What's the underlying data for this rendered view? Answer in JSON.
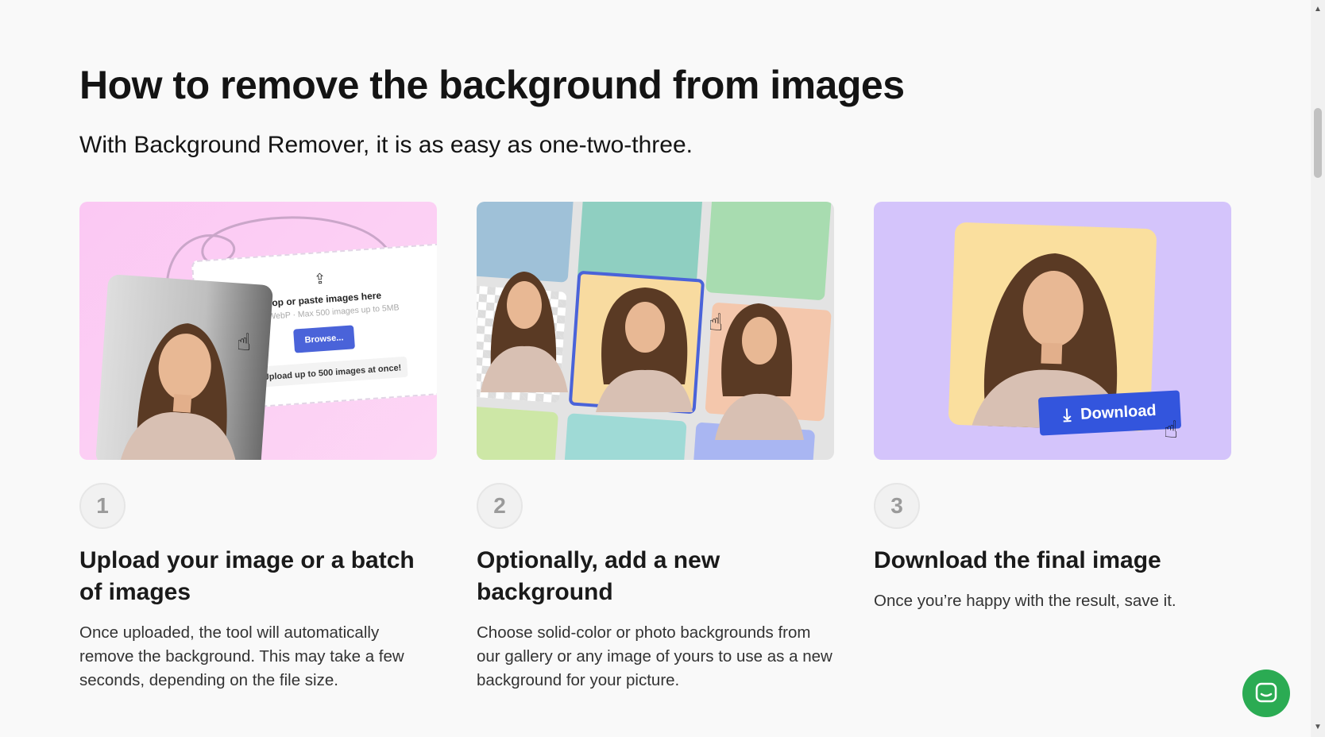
{
  "heading": {
    "title": "How to remove the background from images",
    "subtitle": "With Background Remover, it is as easy as one-two-three."
  },
  "steps": [
    {
      "number": "1",
      "title": "Upload your image or a batch of images",
      "description": "Once uploaded, the tool will automatically remove the background. This may take a few seconds, depending on the file size.",
      "illustration": {
        "drop_title": "Drop or paste images here",
        "drop_formats": "PNG, WebP · Max 500 images up to 5MB",
        "browse_label": "Browse...",
        "note": "Upload up to 500 images at once!",
        "upload_icon": "upload-icon",
        "info_icon": "info-icon"
      }
    },
    {
      "number": "2",
      "title": "Optionally, add a new background",
      "description": "Choose solid-color or photo backgrounds from our gallery or any image of yours to use as a new background for your picture."
    },
    {
      "number": "3",
      "title": "Download the final image",
      "description": "Once you’re happy with the result, save it.",
      "illustration": {
        "download_label": "Download",
        "download_icon": "download-icon"
      }
    }
  ],
  "colors": {
    "card1_bg": "#fbc8f3",
    "card3_bg": "#d4c4fb",
    "accent_blue": "#3355dd",
    "chat_green": "#2bab53"
  },
  "chat_widget": {
    "icon": "chat-icon"
  }
}
